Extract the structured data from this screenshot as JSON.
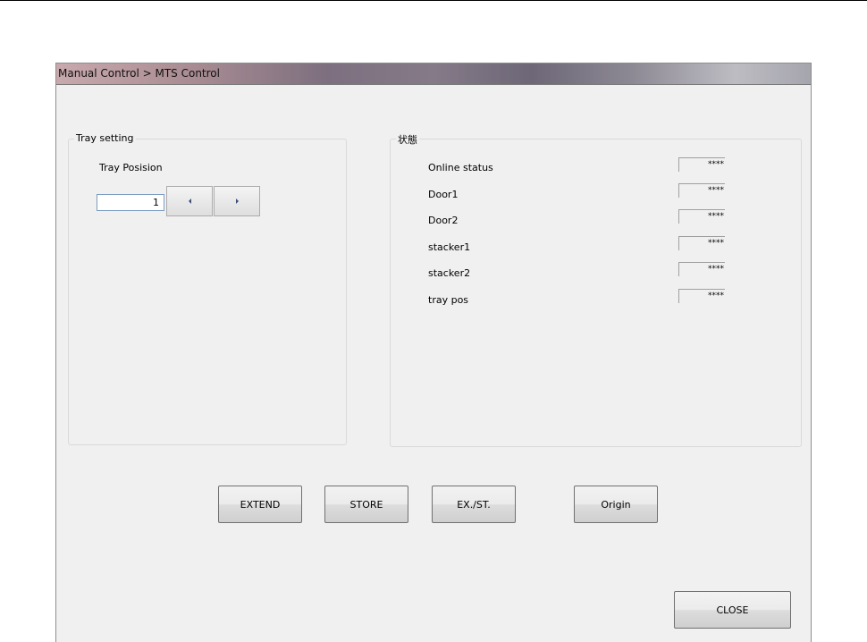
{
  "window": {
    "title": "Manual Control > MTS Control"
  },
  "tray_setting": {
    "group_title": "Tray setting",
    "position_label": "Tray Posision",
    "position_value": "1"
  },
  "status": {
    "group_title": "状態",
    "items": [
      {
        "label": "Online status",
        "value": "****"
      },
      {
        "label": "Door1",
        "value": "****"
      },
      {
        "label": "Door2",
        "value": "****"
      },
      {
        "label": "stacker1",
        "value": "****"
      },
      {
        "label": "stacker2",
        "value": "****"
      },
      {
        "label": "tray pos",
        "value": "****"
      }
    ]
  },
  "actions": {
    "extend": "EXTEND",
    "store": "STORE",
    "ex_st": "EX./ST.",
    "origin": "Origin",
    "close": "CLOSE"
  },
  "icons": {
    "prev": "triangle-left-icon",
    "next": "triangle-right-icon"
  }
}
